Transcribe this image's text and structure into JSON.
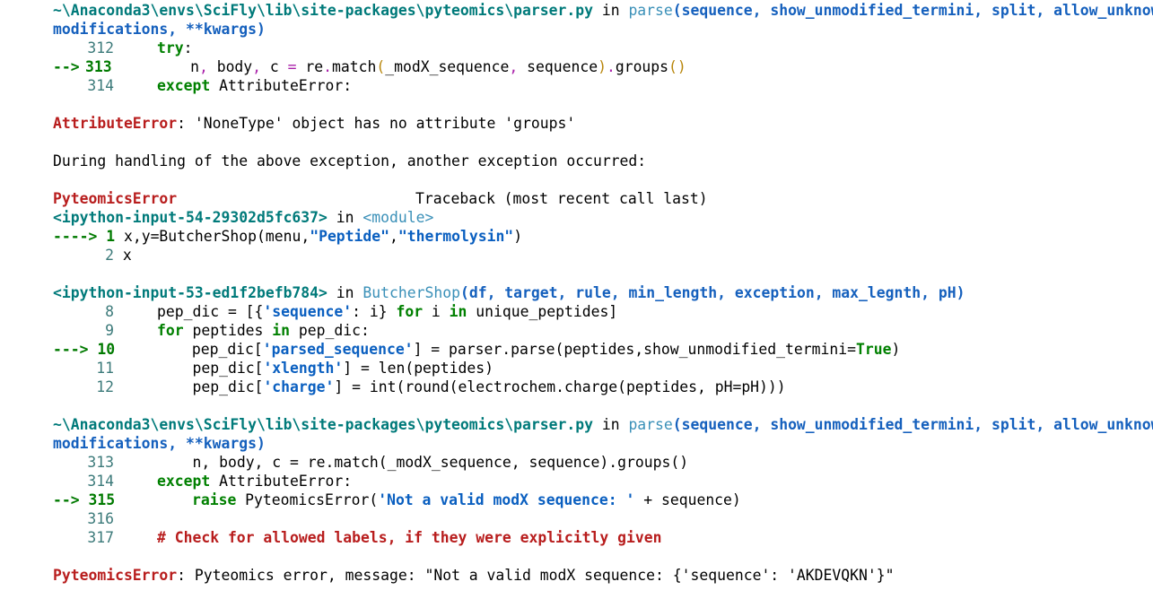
{
  "frame1": {
    "path": "~\\Anaconda3\\envs\\SciFly\\lib\\site-packages\\pyteomics\\parser.py",
    "in_word": " in ",
    "func": "parse",
    "sig": "(sequence, show_unmodified_termini, split, allow_unknown_",
    "sig_cont": "modifications, **kwargs)",
    "lines": [
      {
        "num": "312",
        "code": "    try:"
      },
      {
        "num": "313",
        "code": "        n, body, c = re.match(_modX_sequence, sequence).groups()"
      },
      {
        "num": "314",
        "code": "    except AttributeError:"
      }
    ]
  },
  "err1": {
    "name": "AttributeError",
    "msg": ": 'NoneType' object has no attribute 'groups'"
  },
  "during": "During handling of the above exception, another exception occurred:",
  "header": {
    "name": "PyteomicsError",
    "traceback": "Traceback (most recent call last)"
  },
  "frame2": {
    "loc": "<ipython-input-54-29302d5fc637>",
    "in_word": " in ",
    "func": "<module>",
    "line1_arrow": "---->",
    "line1_num": "1",
    "line1_code_a": " x,y=ButcherShop(menu,",
    "line1_str_a": "\"Peptide\"",
    "line1_comma": ",",
    "line1_str_b": "\"thermolysin\"",
    "line1_close": ")",
    "line2_num": "2",
    "line2_code": " x"
  },
  "frame3": {
    "loc": "<ipython-input-53-ed1f2befb784>",
    "in_word": " in ",
    "func": "ButcherShop",
    "sig": "(df, target, rule, min_length, exception, max_legnth, pH)",
    "l8_num": "8",
    "l8_a": "pep_dic = [{",
    "l8_s": "'sequence'",
    "l8_b": ": i} ",
    "l8_for": "for",
    "l8_c": " i ",
    "l8_in": "in",
    "l8_d": " unique_peptides]",
    "l9_num": "9",
    "l9_for": "for",
    "l9_a": " peptides ",
    "l9_in": "in",
    "l9_b": " pep_dic:",
    "l10_arrow": "--->",
    "l10_num": "10",
    "l10_a": "pep_dic[",
    "l10_s": "'parsed_sequence'",
    "l10_b": "] = parser.parse(peptides,show_unmodified_termini=",
    "l10_true": "True",
    "l10_c": ")",
    "l11_num": "11",
    "l11_a": "pep_dic[",
    "l11_s": "'xlength'",
    "l11_b": "] = len(peptides)",
    "l12_num": "12",
    "l12_a": "pep_dic[",
    "l12_s": "'charge'",
    "l12_b": "] = int(round(electrochem.charge(peptides, pH=pH)))"
  },
  "frame4": {
    "path": "~\\Anaconda3\\envs\\SciFly\\lib\\site-packages\\pyteomics\\parser.py",
    "in_word": " in ",
    "func": "parse",
    "sig": "(sequence, show_unmodified_termini, split, allow_unknown_",
    "sig_cont": "modifications, **kwargs)",
    "l313_num": "313",
    "l313_code": "n, body, c = re.match(_modX_sequence, sequence).groups()",
    "l314_num": "314",
    "l314_kw": "except",
    "l314_code": " AttributeError:",
    "l315_arrow": "-->",
    "l315_num": "315",
    "l315_kw": "raise",
    "l315_a": " PyteomicsError(",
    "l315_s": "'Not a valid modX sequence: '",
    "l315_b": " + sequence)",
    "l316_num": "316",
    "l317_num": "317",
    "l317_com": "# Check for allowed labels, if they were explicitly given"
  },
  "err2": {
    "name": "PyteomicsError",
    "msg": ": Pyteomics error, message: \"Not a valid modX sequence: {'sequence': 'AKDEVQKN'}\""
  }
}
